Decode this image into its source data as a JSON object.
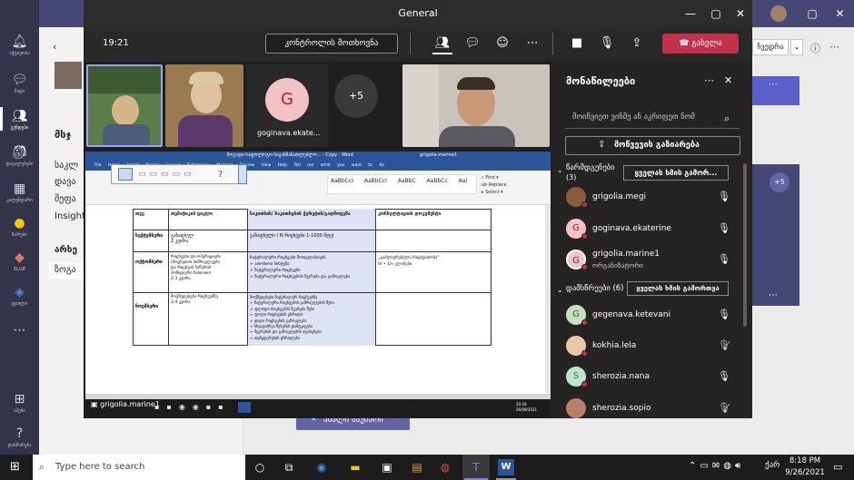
{
  "window": {
    "title": "General"
  },
  "rail": {
    "items": [
      {
        "label": "აქტივობა",
        "icon": "bell-icon"
      },
      {
        "label": "ჩატი",
        "icon": "chat-icon"
      },
      {
        "label": "გუნდები",
        "icon": "teams-icon"
      },
      {
        "label": "დავალებები",
        "icon": "assignments-icon"
      },
      {
        "label": "კალენდარი",
        "icon": "calendar-icon"
      },
      {
        "label": "ზარები",
        "icon": "calls-icon"
      },
      {
        "label": "ფაილები",
        "icon": "files-icon"
      },
      {
        "label": "ELGE",
        "icon": "elge-icon"
      },
      {
        "label": "ფაილი",
        "icon": "file-icon"
      },
      {
        "label": "აპები",
        "icon": "apps-icon"
      },
      {
        "label": "დახმარება",
        "icon": "help-icon"
      }
    ]
  },
  "background": {
    "sidebar_lines": [
      "მსჯ",
      "საკლ",
      "დავა",
      "შეფა",
      "Insights",
      "არხე",
      "ზოგა"
    ],
    "new_conversation": "ახალი საუბარი",
    "menu_label": "ჩვედრა"
  },
  "call": {
    "timer": "19:21",
    "meeting_options": "კონტროლის მოთხოვნა",
    "leave_label": "გასვლა",
    "tiles": [
      {
        "name": "",
        "kind": "video"
      },
      {
        "name": "",
        "kind": "video"
      },
      {
        "name": "goginava.ekate...",
        "initial": "G",
        "kind": "avatar"
      },
      {
        "name": "+5",
        "kind": "more"
      },
      {
        "name": "",
        "kind": "video"
      }
    ],
    "share_caption": "grigolia.marine1"
  },
  "document": {
    "title_bar": "ზოგადი-საფოლოგო-საგანმანათლებლო... - Copy - Word",
    "user": "grigolia.marine1",
    "ribbon_tabs": [
      "File",
      "Home",
      "Insert",
      "Design",
      "Layout",
      "References",
      "Mailings",
      "Review",
      "View",
      "Help",
      "Tell me what you want to do"
    ],
    "table_headers": [
      "თვე",
      "თემატიკის ციკლი",
      "საკითხის/ საკითხების ჭვრეტის/გადმოცემა",
      "კონსულტაციის დოკუმენტი"
    ],
    "rows": [
      {
        "c1": "სექტემბერი",
        "c2": "გაზაფხულ\n2 კვირა",
        "c3": "გაზაფხული ( N რიცხვები 1-1000 მდე)",
        "c4": ""
      },
      {
        "c1": "ოქტომბერი",
        "c2": "რიცხვები და ოპერაციები\n(რიცხვითი სიმრავლეები\nდა რიცხვის ჩაწერის\nპოზიციური ხასიათი)\n2-3 კვირა",
        "c3": "ნატურალური რიცხვები მოთვლისთვის\n➢ ათობითი სისტემა\n➢ ნატურალური რიცხვები\n➢ ნატურალური რიცხვების შეკრება და გამოკლება",
        "c4": "„გაძლიერებული რიცხვითობა\"\nIV • 1/n   კლასები"
      },
      {
        "c1": "ნოემბერი",
        "c2": "მოქმედებები რიცხვებზე\n3-4 კვირა",
        "c3": "მოქმედებები ნატურალურ რიცხვებზე\n➢ ნატურალური რიცხვების გამრავლების წესი\n➢ ფლოდი რიცხვების შეკრება წესი\n➢ ფოლი რიცხვების ცხრილი\n➢ დიდი რიცხვების გამოკლება\n➢ სხვადასხვა წესების დამტკიცება\n➢ შეკრების და გამოკლების თვისებები\n➢ თუმცდერების ცხრილები",
        "c4": ""
      }
    ]
  },
  "participants": {
    "title": "მონაწილეები",
    "invite_placeholder": "მოიწვიეთ ვინმე ან აკრიფეთ ნომ",
    "share_invite": "მოწვევის გაზიარება",
    "presenters_label": "წარმდგენები",
    "presenters_count": "(3)",
    "attendees_label": "დამსწრეები (6)",
    "mute_all": "ყველას ხმის გამორ...",
    "mute_all_2": "ყველას ხმის გამორთვა",
    "presenters": [
      {
        "name": "grigolia.megi",
        "initial": "",
        "color": "#8a5c3a",
        "mic": "on"
      },
      {
        "name": "goginava.ekaterine",
        "initial": "G",
        "color": "#a4262c",
        "mic": "on"
      },
      {
        "name": "grigolia.marine1",
        "sub": "ორგანიზატორი",
        "initial": "G",
        "color": "#6b2a5d",
        "mic": "on"
      }
    ],
    "attendees": [
      {
        "name": "gegenava.ketevani",
        "initial": "G",
        "color": "#4a8a3d",
        "mic": "on"
      },
      {
        "name": "kokhia.lela",
        "initial": "",
        "color": "#7a6a5a",
        "mic": "off"
      },
      {
        "name": "sherozia.nana",
        "initial": "S",
        "color": "#3b8a5a",
        "mic": "on"
      },
      {
        "name": "sherozia.sopio",
        "initial": "",
        "color": "#8a4a3a",
        "mic": "off"
      }
    ]
  },
  "taskbar": {
    "search_placeholder": "Type here to search",
    "time": "8:18 PM",
    "date": "9/26/2021",
    "lang": "ქარ"
  },
  "colors": {
    "rail": "#33344a",
    "topbar": "#464775",
    "leave": "#c4314b",
    "panel": "#252423"
  }
}
